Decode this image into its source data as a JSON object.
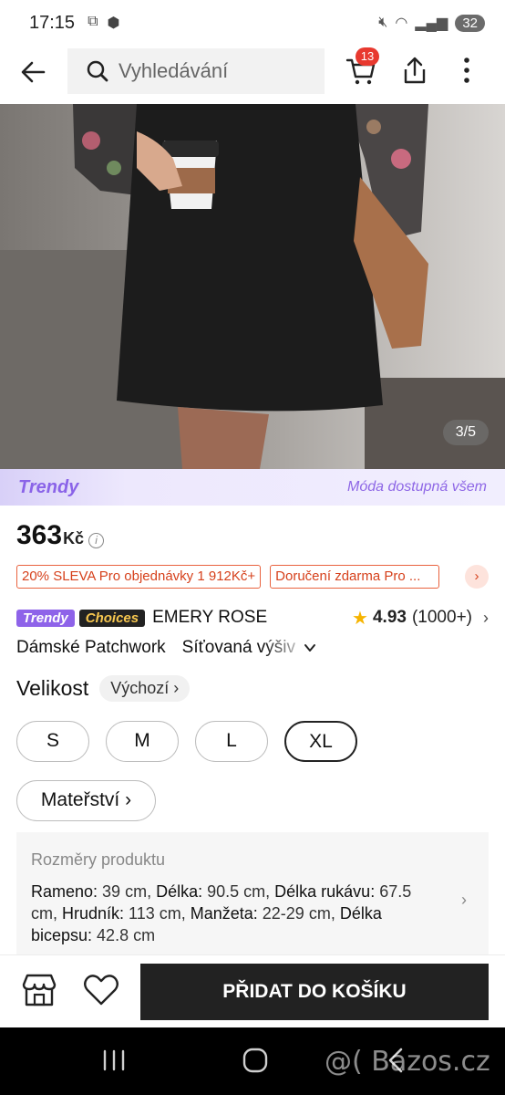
{
  "status_bar": {
    "time": "17:15",
    "battery": "32"
  },
  "search": {
    "placeholder": "Vyhledávání"
  },
  "cart": {
    "badge_count": "13"
  },
  "gallery": {
    "counter": "3/5"
  },
  "banner": {
    "logo": "Trendy",
    "slogan": "Móda dostupná všem"
  },
  "price": {
    "amount": "363",
    "currency": "Kč"
  },
  "promos": [
    "20% SLEVA Pro objednávky 1 912Kč+",
    "Doručení zdarma Pro ..."
  ],
  "brand": {
    "tag_trendy": "Trendy",
    "tag_choices": "Choices",
    "name": "EMERY ROSE"
  },
  "rating": {
    "value": "4.93",
    "count": "(1000+)"
  },
  "title": {
    "part1": "Dámské Patchwork",
    "part2": "Síťovaná výšiv"
  },
  "size": {
    "label": "Velikost",
    "chip": "Výchozí",
    "options": [
      "S",
      "M",
      "L",
      "XL"
    ],
    "selected": "XL",
    "maternity": "Mateřství"
  },
  "dimensions": {
    "title": "Rozměry produktu",
    "items": [
      {
        "label": "Rameno:",
        "value": " 39 cm, "
      },
      {
        "label": "Délka:",
        "value": " 90.5 cm, "
      },
      {
        "label": "Délka rukávu:",
        "value": " 67.5 cm, "
      },
      {
        "label": "Hrudník:",
        "value": " 113 cm, "
      },
      {
        "label": "Manžeta:",
        "value": " 22-29 cm, "
      },
      {
        "label": "Délka bicepsu:",
        "value": " 42.8 cm"
      }
    ]
  },
  "actions": {
    "add_to_cart": "PŘIDAT DO KOŠÍKU"
  },
  "watermark": "@( Bazos.cz",
  "colors": {
    "accent_promo": "#d6411c",
    "trendy_purple": "#8e63e9",
    "cart_badge": "#e8392f",
    "primary_button": "#222222",
    "star": "#f6b400"
  }
}
